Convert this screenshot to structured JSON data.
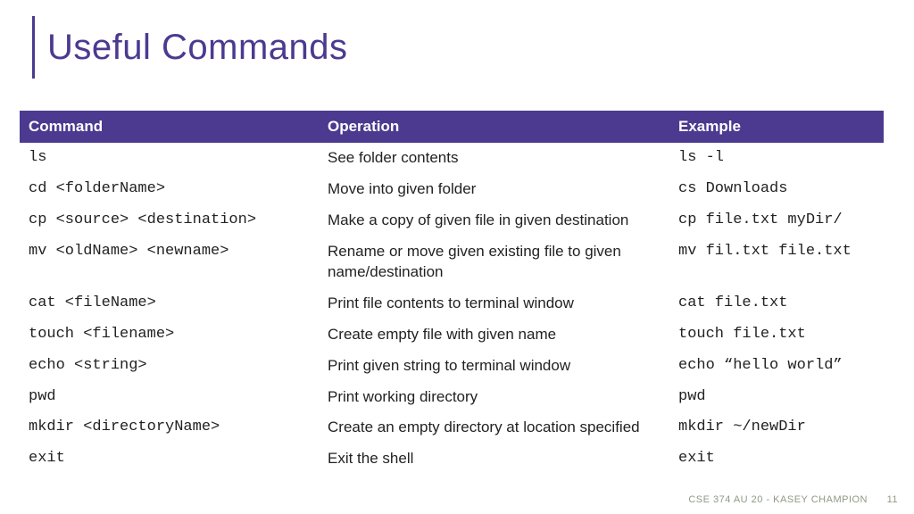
{
  "title": "Useful Commands",
  "headers": {
    "command": "Command",
    "operation": "Operation",
    "example": "Example"
  },
  "rows": [
    {
      "command": "ls",
      "operation": "See folder contents",
      "example": "ls -l"
    },
    {
      "command": "cd <folderName>",
      "operation": "Move into given folder",
      "example": "cs Downloads"
    },
    {
      "command": "cp <source> <destination>",
      "operation": "Make a copy of given file in given destination",
      "example": "cp file.txt myDir/"
    },
    {
      "command": "mv <oldName> <newname>",
      "operation": "Rename or move given existing file to given name/destination",
      "example": "mv fil.txt file.txt"
    },
    {
      "command": "cat <fileName>",
      "operation": "Print file contents to terminal window",
      "example": "cat file.txt"
    },
    {
      "command": "touch <filename>",
      "operation": "Create empty file with given name",
      "example": "touch file.txt"
    },
    {
      "command": "echo <string>",
      "operation": "Print given string to terminal window",
      "example": "echo “hello world”"
    },
    {
      "command": "pwd",
      "operation": "Print working directory",
      "example": "pwd"
    },
    {
      "command": "mkdir <directoryName>",
      "operation": "Create an empty directory at location specified",
      "example": "mkdir ~/newDir"
    },
    {
      "command": "exit",
      "operation": "Exit the shell",
      "example": "exit"
    }
  ],
  "footer": {
    "course": "CSE 374 AU 20 - KASEY CHAMPION",
    "page": "11"
  }
}
